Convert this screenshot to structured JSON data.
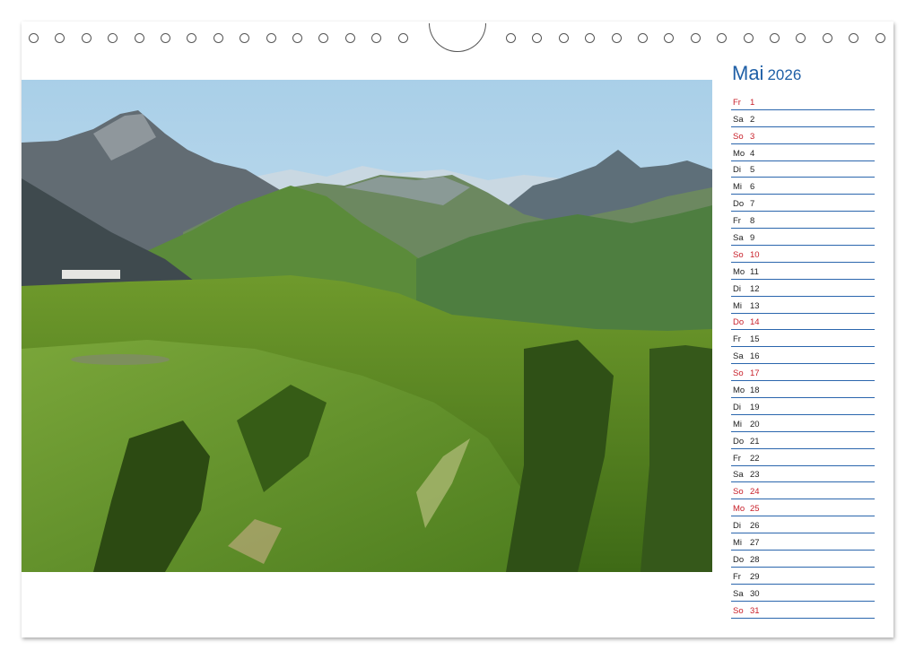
{
  "calendar": {
    "month": "Mai",
    "year": "2026",
    "days": [
      {
        "wd": "Fr",
        "d": "1",
        "red": true
      },
      {
        "wd": "Sa",
        "d": "2",
        "red": false
      },
      {
        "wd": "So",
        "d": "3",
        "red": true
      },
      {
        "wd": "Mo",
        "d": "4",
        "red": false
      },
      {
        "wd": "Di",
        "d": "5",
        "red": false
      },
      {
        "wd": "Mi",
        "d": "6",
        "red": false
      },
      {
        "wd": "Do",
        "d": "7",
        "red": false
      },
      {
        "wd": "Fr",
        "d": "8",
        "red": false
      },
      {
        "wd": "Sa",
        "d": "9",
        "red": false
      },
      {
        "wd": "So",
        "d": "10",
        "red": true
      },
      {
        "wd": "Mo",
        "d": "11",
        "red": false
      },
      {
        "wd": "Di",
        "d": "12",
        "red": false
      },
      {
        "wd": "Mi",
        "d": "13",
        "red": false
      },
      {
        "wd": "Do",
        "d": "14",
        "red": true
      },
      {
        "wd": "Fr",
        "d": "15",
        "red": false
      },
      {
        "wd": "Sa",
        "d": "16",
        "red": false
      },
      {
        "wd": "So",
        "d": "17",
        "red": true
      },
      {
        "wd": "Mo",
        "d": "18",
        "red": false
      },
      {
        "wd": "Di",
        "d": "19",
        "red": false
      },
      {
        "wd": "Mi",
        "d": "20",
        "red": false
      },
      {
        "wd": "Do",
        "d": "21",
        "red": false
      },
      {
        "wd": "Fr",
        "d": "22",
        "red": false
      },
      {
        "wd": "Sa",
        "d": "23",
        "red": false
      },
      {
        "wd": "So",
        "d": "24",
        "red": true
      },
      {
        "wd": "Mo",
        "d": "25",
        "red": true
      },
      {
        "wd": "Di",
        "d": "26",
        "red": false
      },
      {
        "wd": "Mi",
        "d": "27",
        "red": false
      },
      {
        "wd": "Do",
        "d": "28",
        "red": false
      },
      {
        "wd": "Fr",
        "d": "29",
        "red": false
      },
      {
        "wd": "Sa",
        "d": "30",
        "red": false
      },
      {
        "wd": "So",
        "d": "31",
        "red": true
      }
    ]
  },
  "colors": {
    "accent_blue": "#1f5fa6",
    "holiday_red": "#c8202a"
  }
}
